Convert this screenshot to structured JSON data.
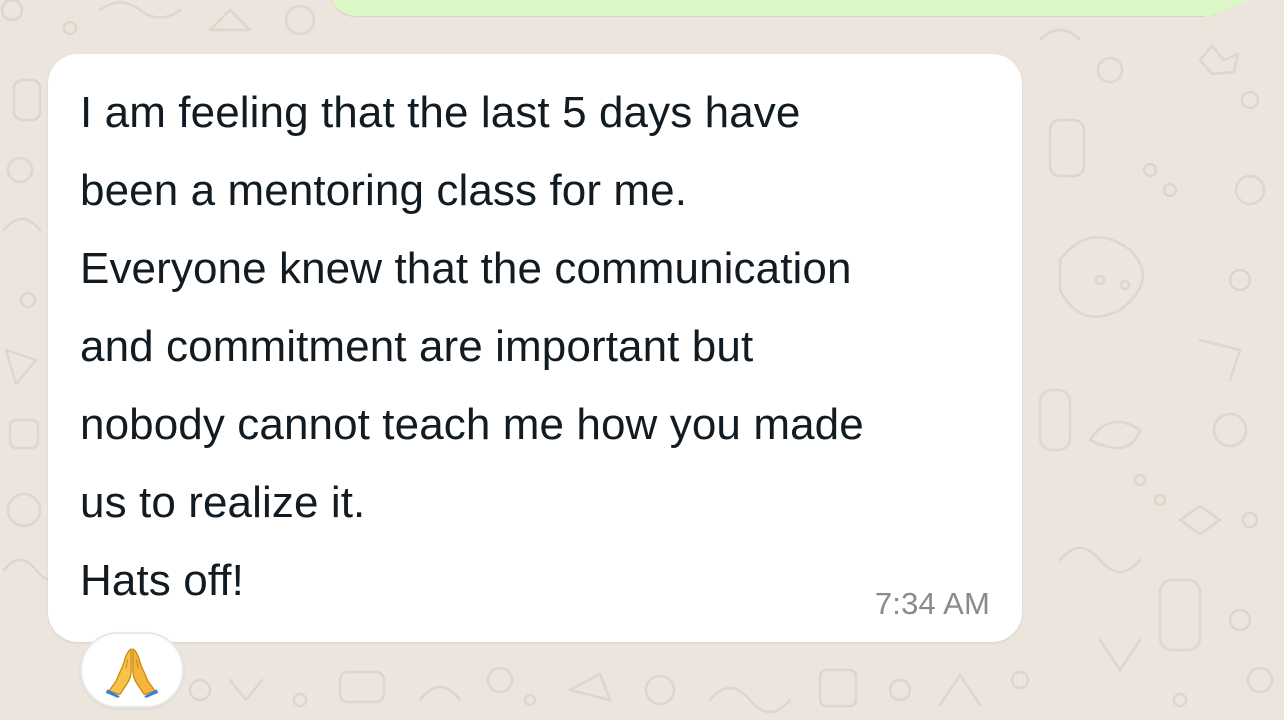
{
  "chat": {
    "incoming_message": {
      "lines": [
        "I am feeling that the last 5 days have",
        "been a mentoring class for me.",
        "Everyone knew that the communication",
        "and commitment are important but",
        "nobody cannot teach me how you made",
        "us to realize it.",
        "Hats off!"
      ],
      "time": "7:34 AM",
      "reaction": {
        "emoji": "🙏",
        "icon": "folded-hands-icon"
      }
    }
  },
  "colors": {
    "wallpaper": "#ece5dd",
    "incoming_bubble": "#ffffff",
    "outgoing_bubble": "#dcf8c6",
    "text": "#111b21",
    "timestamp": "#8a8a8a"
  }
}
